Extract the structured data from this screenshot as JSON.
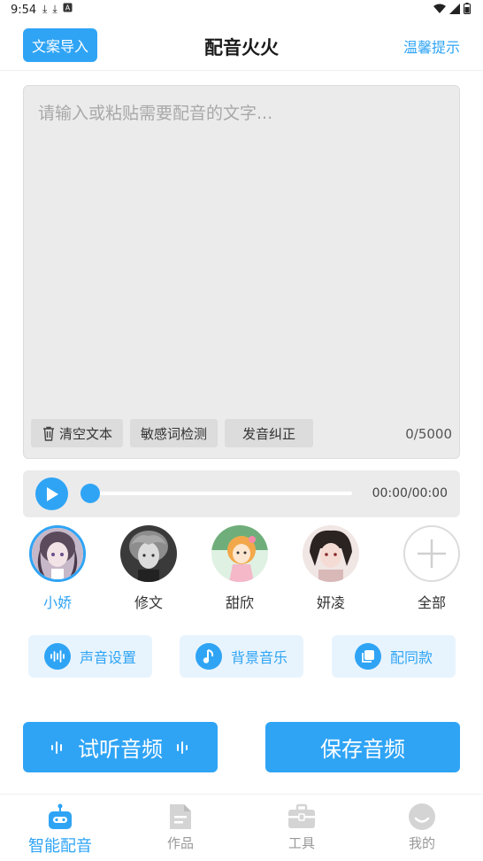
{
  "status_bar": {
    "time": "9:54"
  },
  "header": {
    "import_label": "文案导入",
    "title": "配音火火",
    "tips_label": "温馨提示"
  },
  "editor": {
    "placeholder": "请输入或粘贴需要配音的文字...",
    "value": "",
    "clear_label": "清空文本",
    "sensitive_label": "敏感词检测",
    "pronounce_label": "发音纠正",
    "char_count": "0/5000"
  },
  "player": {
    "time": "00:00/00:00",
    "progress": 0.0
  },
  "voices": [
    {
      "name": "小娇",
      "selected": true
    },
    {
      "name": "修文",
      "selected": false
    },
    {
      "name": "甜欣",
      "selected": false
    },
    {
      "name": "妍凌",
      "selected": false
    }
  ],
  "all_voices_label": "全部",
  "options": {
    "voice_settings": "声音设置",
    "bg_music": "背景音乐",
    "same_style": "配同款"
  },
  "actions": {
    "preview": "试听音频",
    "save": "保存音频"
  },
  "nav": {
    "items": [
      {
        "label": "智能配音",
        "active": true
      },
      {
        "label": "作品",
        "active": false
      },
      {
        "label": "工具",
        "active": false
      },
      {
        "label": "我的",
        "active": false
      }
    ]
  },
  "colors": {
    "accent": "#2fa4f5",
    "inactive": "#c8c8c8"
  }
}
